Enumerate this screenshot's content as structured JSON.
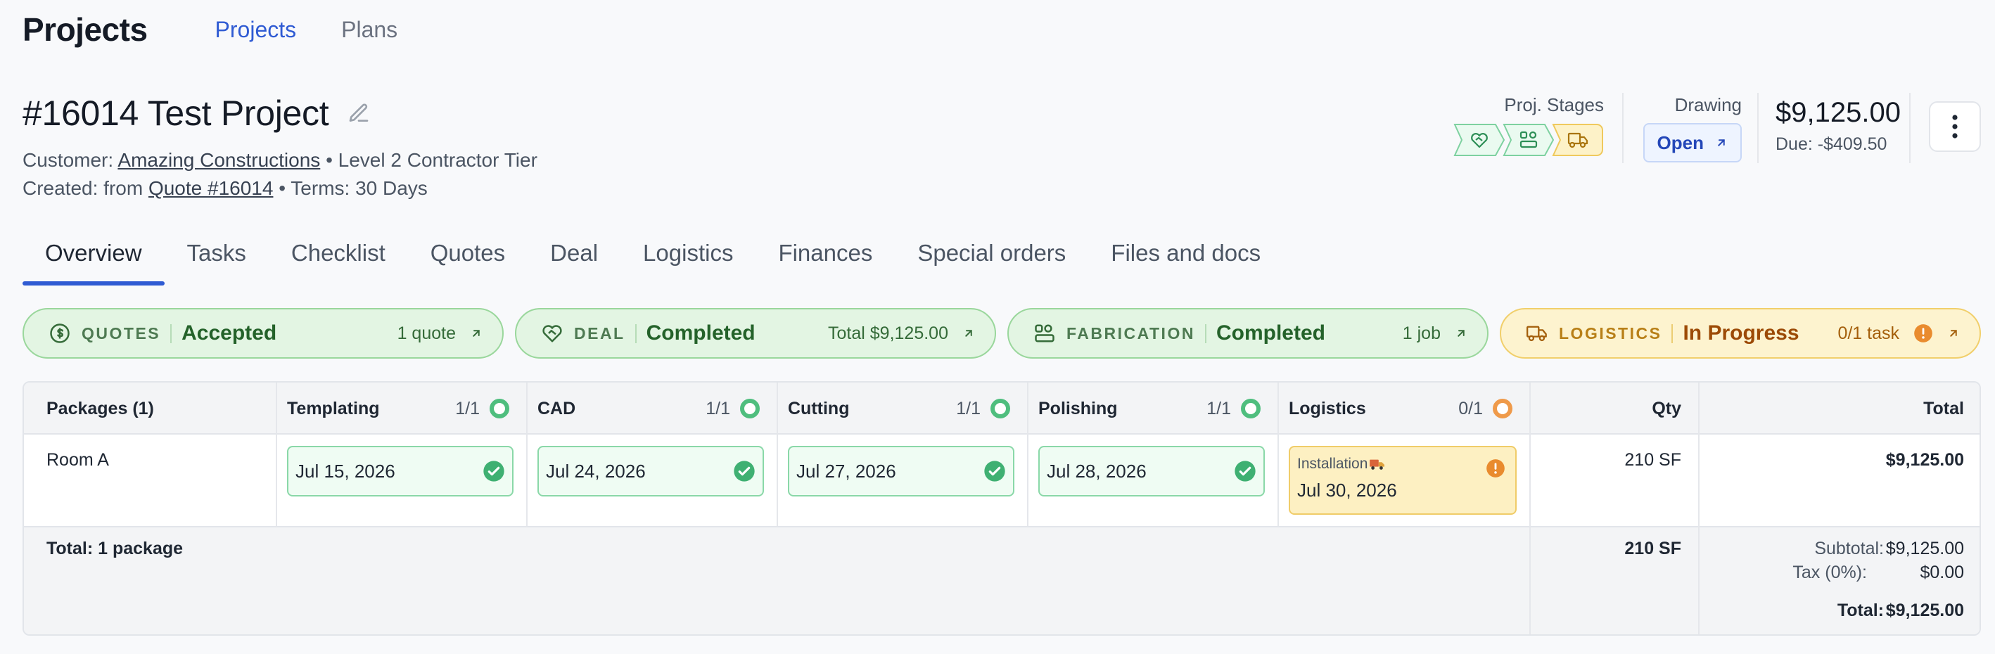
{
  "app": {
    "title": "Projects"
  },
  "nav": {
    "items": [
      {
        "label": "Projects",
        "active": true
      },
      {
        "label": "Plans",
        "active": false
      }
    ]
  },
  "project": {
    "title": "#16014 Test Project",
    "customer_prefix": "Customer:",
    "customer_name": "Amazing Constructions",
    "customer_tier": " • Level 2 Contractor Tier",
    "created_prefix": "Created: from",
    "quote_link": "Quote #16014",
    "terms": " • Terms: 30 Days"
  },
  "stages": {
    "label": "Proj. Stages",
    "icons": [
      "handshake-icon",
      "fabrication-icon",
      "truck-icon"
    ]
  },
  "drawing": {
    "label": "Drawing",
    "button": "Open"
  },
  "price": {
    "amount": "$9,125.00",
    "due": "Due: -$409.50"
  },
  "tabs": [
    {
      "label": "Overview",
      "active": true
    },
    {
      "label": "Tasks"
    },
    {
      "label": "Checklist"
    },
    {
      "label": "Quotes"
    },
    {
      "label": "Deal"
    },
    {
      "label": "Logistics"
    },
    {
      "label": "Finances"
    },
    {
      "label": "Special orders"
    },
    {
      "label": "Files and docs"
    }
  ],
  "status_pills": [
    {
      "category": "QUOTES",
      "state": "Accepted",
      "info": "1 quote",
      "color": "#24622a"
    },
    {
      "category": "DEAL",
      "state": "Completed",
      "info": "Total $9,125.00",
      "color": "#24622a"
    },
    {
      "category": "FABRICATION",
      "state": "Completed",
      "info": "1 job",
      "color": "#24622a"
    },
    {
      "category": "LOGISTICS",
      "state": "In Progress",
      "info": "0/1 task",
      "color": "#9c4a06"
    }
  ],
  "table": {
    "headers": {
      "packages": "Packages (1)",
      "templating": "Templating",
      "templating_count": "1/1",
      "cad": "CAD",
      "cad_count": "1/1",
      "cutting": "Cutting",
      "cutting_count": "1/1",
      "polishing": "Polishing",
      "polishing_count": "1/1",
      "logistics": "Logistics",
      "logistics_count": "0/1",
      "qty": "Qty",
      "total": "Total"
    },
    "row": {
      "name": "Room A",
      "templating": "Jul 15, 2026",
      "cad": "Jul 24, 2026",
      "cutting": "Jul 27, 2026",
      "polishing": "Jul 28, 2026",
      "logistics_sub": "Installation",
      "logistics_date": "Jul 30, 2026",
      "qty": "210 SF",
      "total": "$9,125.00"
    },
    "footer": {
      "label": "Total: 1 package",
      "qty": "210 SF",
      "subtotal_label": "Subtotal:",
      "subtotal": "$9,125.00",
      "tax_label": "Tax (0%):",
      "tax": "$0.00",
      "total_label": "Total:",
      "total": "$9,125.00"
    }
  }
}
